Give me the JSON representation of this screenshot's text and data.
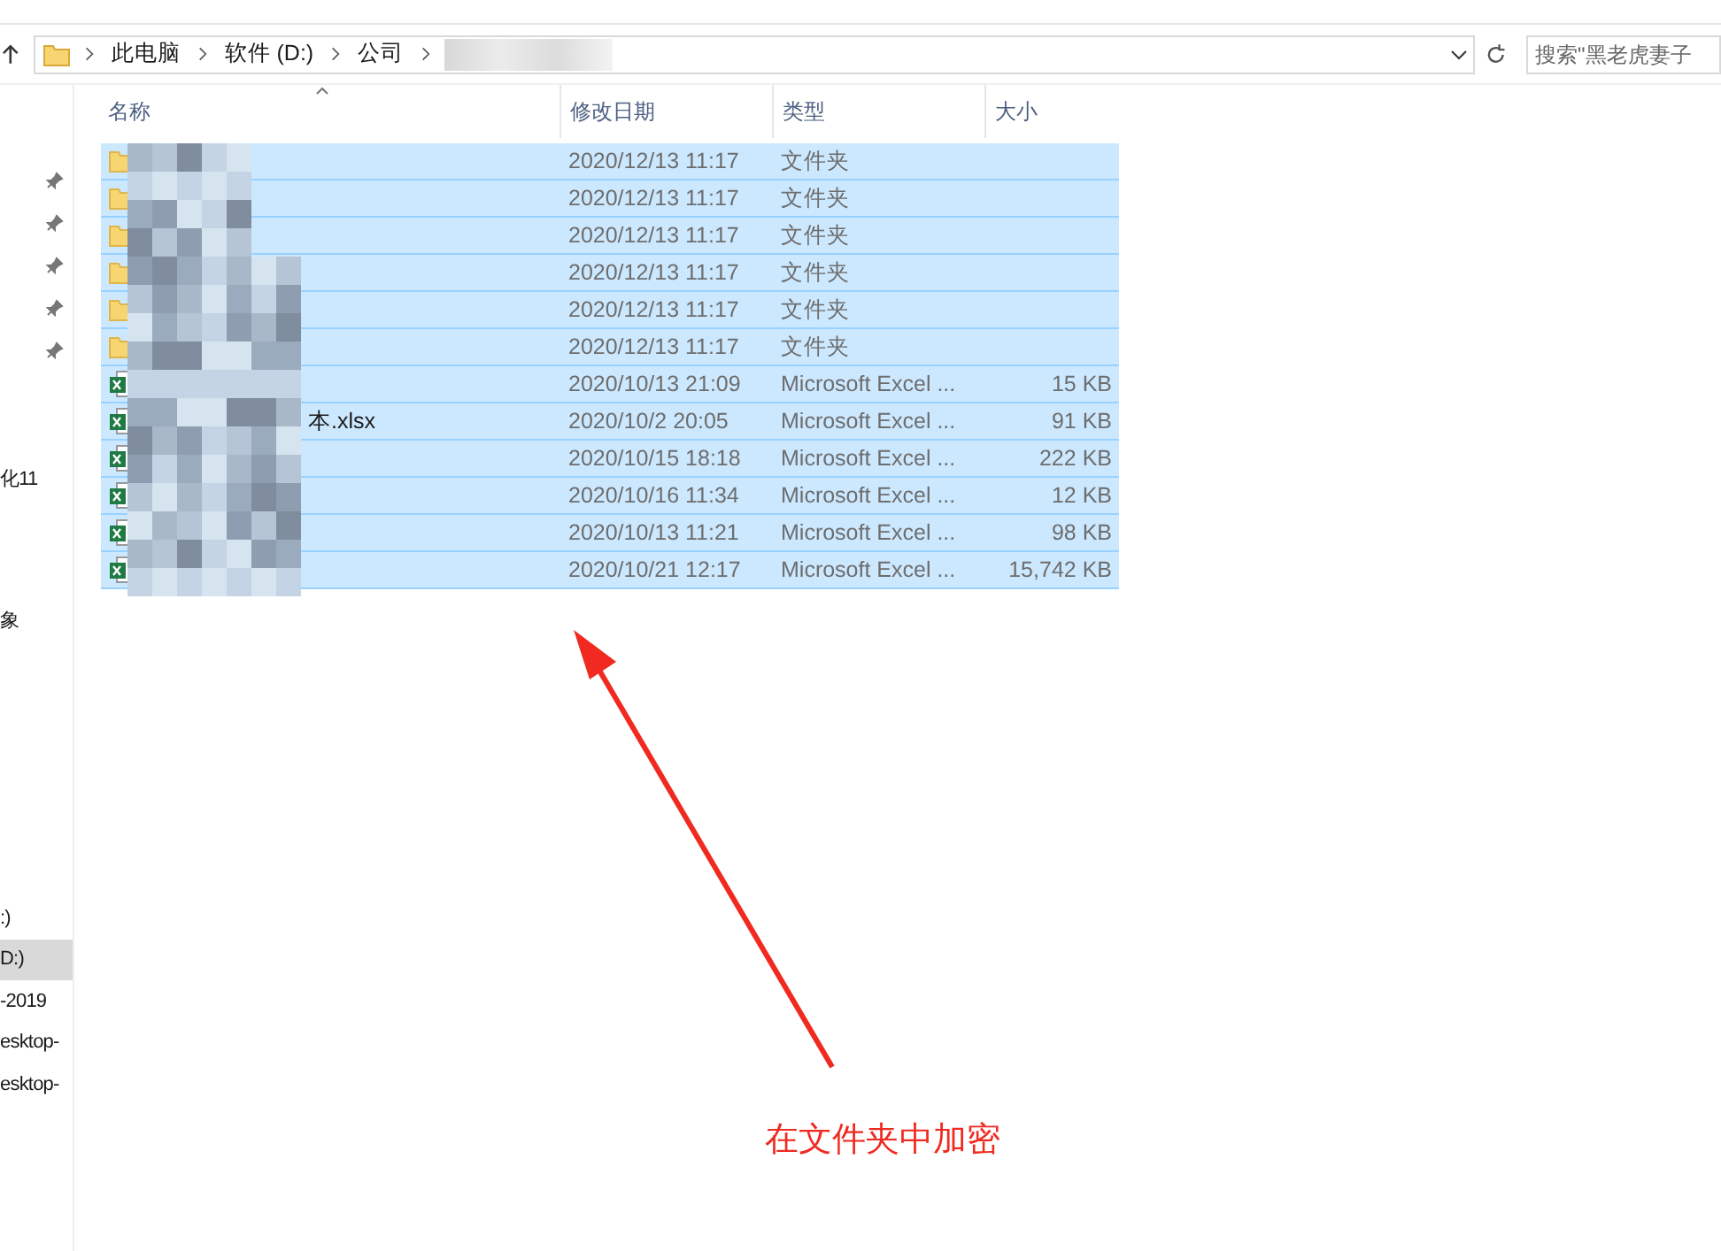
{
  "address_bar": {
    "crumbs": [
      "此电脑",
      "软件 (D:)",
      "公司"
    ]
  },
  "search": {
    "placeholder": "搜索\"黑老虎妻子"
  },
  "sidebar": {
    "pinned_count_items": [
      {
        "pinned": true
      },
      {
        "pinned": true
      },
      {
        "pinned": true
      },
      {
        "pinned": true
      },
      {
        "pinned": true
      }
    ],
    "items": [
      {
        "label": "化11",
        "selected": false
      },
      {
        "label": "象",
        "selected": false
      },
      {
        "label": ":)",
        "selected": false
      },
      {
        "label": "D:)",
        "selected": true
      },
      {
        "label": "-2019",
        "selected": false
      },
      {
        "label": "esktop-",
        "selected": false
      },
      {
        "label": "esktop-",
        "selected": false
      }
    ]
  },
  "table": {
    "columns": [
      "名称",
      "修改日期",
      "类型",
      "大小"
    ],
    "rows": [
      {
        "kind": "folder",
        "name": "",
        "date": "2020/12/13 11:17",
        "type": "文件夹",
        "size": "",
        "selected": true
      },
      {
        "kind": "folder",
        "name": "",
        "date": "2020/12/13 11:17",
        "type": "文件夹",
        "size": "",
        "selected": true
      },
      {
        "kind": "folder",
        "name": "",
        "date": "2020/12/13 11:17",
        "type": "文件夹",
        "size": "",
        "selected": true
      },
      {
        "kind": "folder",
        "name": "",
        "date": "2020/12/13 11:17",
        "type": "文件夹",
        "size": "",
        "selected": true
      },
      {
        "kind": "folder",
        "name": "",
        "date": "2020/12/13 11:17",
        "type": "文件夹",
        "size": "",
        "selected": true
      },
      {
        "kind": "folder",
        "name": "",
        "date": "2020/12/13 11:17",
        "type": "文件夹",
        "size": "",
        "selected": true
      },
      {
        "kind": "excel",
        "name": "",
        "date": "2020/10/13 21:09",
        "type": "Microsoft Excel ...",
        "size": "15 KB",
        "selected": true
      },
      {
        "kind": "excel",
        "name": "本.xlsx",
        "date": "2020/10/2 20:05",
        "type": "Microsoft Excel ...",
        "size": "91 KB",
        "selected": true
      },
      {
        "kind": "excel",
        "name": "",
        "date": "2020/10/15 18:18",
        "type": "Microsoft Excel ...",
        "size": "222 KB",
        "selected": true
      },
      {
        "kind": "excel",
        "name": "",
        "date": "2020/10/16 11:34",
        "type": "Microsoft Excel ...",
        "size": "12 KB",
        "selected": true
      },
      {
        "kind": "excel",
        "name": "",
        "date": "2020/10/13 11:21",
        "type": "Microsoft Excel ...",
        "size": "98 KB",
        "selected": true
      },
      {
        "kind": "excel",
        "name": "",
        "date": "2020/10/21 12:17",
        "type": "Microsoft Excel ...",
        "size": "15,742 KB",
        "selected": true
      }
    ]
  },
  "annotation": {
    "text": "在文件夹中加密"
  }
}
